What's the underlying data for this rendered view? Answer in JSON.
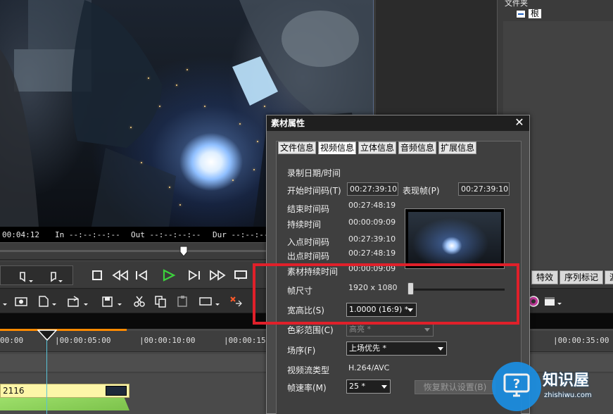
{
  "preview": {
    "timecode_current": "00:04:12",
    "in_label": "In",
    "in_value": "--:--:--:--",
    "out_label": "Out",
    "out_value": "--:--:--:--",
    "dur_label": "Dur",
    "dur_value": "--:--:--:--"
  },
  "transport": {
    "icons": [
      "mark-in-icon",
      "mark-out-icon",
      "stop-icon",
      "rewind-icon",
      "step-back-icon",
      "play-icon",
      "step-forward-icon",
      "fast-forward-icon",
      "loop-icon"
    ]
  },
  "right_tabs": [
    "特效",
    "序列标记",
    "源"
  ],
  "folder_panel": {
    "title": "文件夹",
    "root_label": "根"
  },
  "timeline": {
    "ruler_labels": [
      "00:00",
      "|00:00:05:00",
      "|00:00:10:00",
      "|00:00:15:0",
      "|00:00:35:00"
    ],
    "clip_label": "2116"
  },
  "dialog": {
    "title": "素材属性",
    "close": "✕",
    "tabs": [
      "文件信息",
      "视频信息",
      "立体信息",
      "音频信息",
      "扩展信息"
    ],
    "active_tab_index": 1,
    "record_datetime_label": "录制日期/时间",
    "start_tc_label": "开始时间码(T)",
    "start_tc_value": "00:27:39:10",
    "rep_frame_label": "表现帧(P)",
    "rep_frame_value": "00:27:39:10",
    "end_tc_label": "结束时间码",
    "end_tc_value": "00:27:48:19",
    "duration_label": "持续时间",
    "duration_value": "00:00:09:09",
    "in_point_label": "入点时间码",
    "in_point_value": "00:27:39:10",
    "out_point_label": "出点时间码",
    "out_point_value": "00:27:48:19",
    "clip_duration_label": "素材持续时间",
    "clip_duration_value": "00:00:09:09",
    "frame_size_label": "帧尺寸",
    "frame_size_value": "1920 x 1080",
    "aspect_label": "宽高比(S)",
    "aspect_value": "1.0000 (16:9) *",
    "color_range_label": "色彩范围(C)",
    "color_range_value": "高亮 *",
    "field_order_label": "场序(F)",
    "field_order_value": "上场优先 *",
    "stream_type_label": "视频流类型",
    "stream_type_value": "H.264/AVC",
    "frame_rate_label": "帧速率(M)",
    "frame_rate_value": "25 *",
    "reset_button": "恢复默认设置(B)"
  },
  "watermark": {
    "text": "知识屋",
    "url": "zhishiwu.com"
  },
  "colors": {
    "highlight": "#e0202a",
    "play_green": "#3cd23c",
    "clip_yellow": "#fdf6a8",
    "clip_green": "#8fd45a",
    "watermark_blue": "#1b8fe3"
  }
}
